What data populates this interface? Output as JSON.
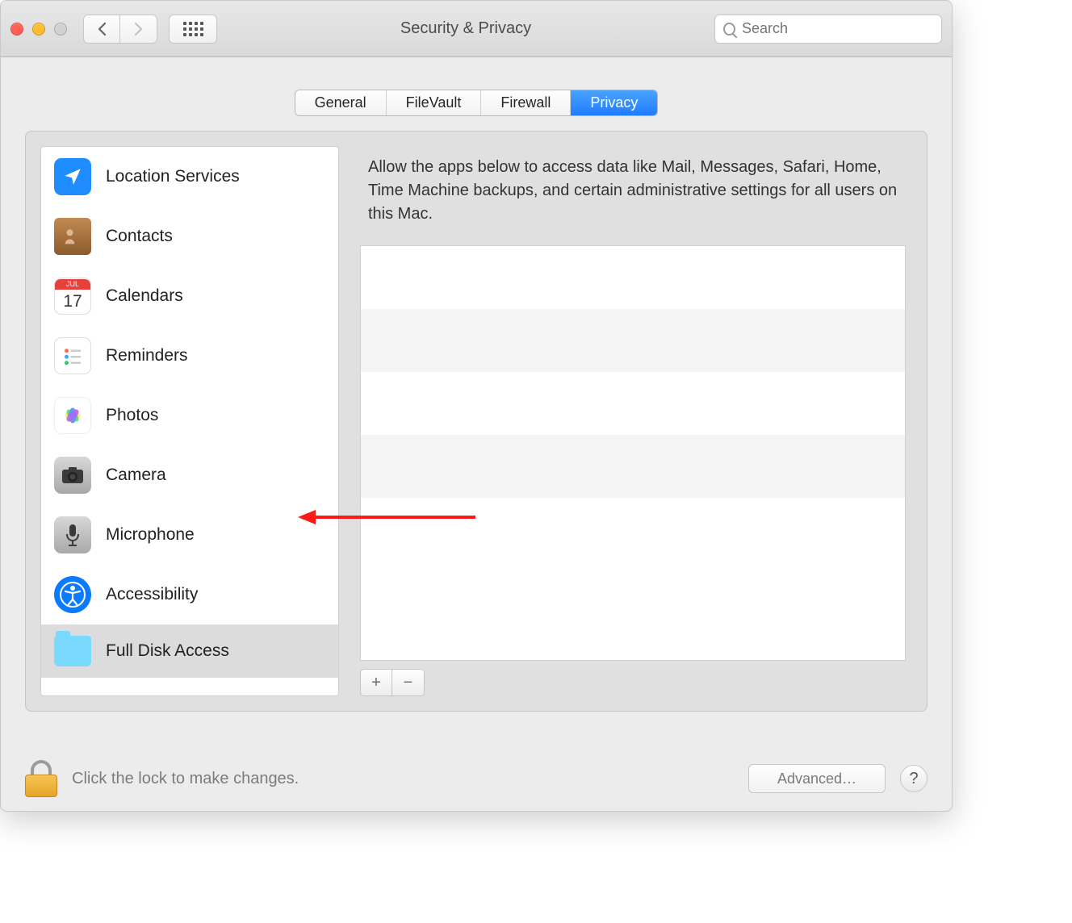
{
  "window": {
    "title": "Security & Privacy"
  },
  "search": {
    "placeholder": "Search"
  },
  "tabs": {
    "items": [
      {
        "label": "General"
      },
      {
        "label": "FileVault"
      },
      {
        "label": "Firewall"
      },
      {
        "label": "Privacy"
      }
    ],
    "active_index": 3
  },
  "sidebar": {
    "items": [
      {
        "label": "Location Services",
        "icon": "location"
      },
      {
        "label": "Contacts",
        "icon": "contacts"
      },
      {
        "label": "Calendars",
        "icon": "calendar",
        "cal_month": "JUL",
        "cal_day": "17"
      },
      {
        "label": "Reminders",
        "icon": "reminders"
      },
      {
        "label": "Photos",
        "icon": "photos"
      },
      {
        "label": "Camera",
        "icon": "camera"
      },
      {
        "label": "Microphone",
        "icon": "microphone"
      },
      {
        "label": "Accessibility",
        "icon": "accessibility"
      },
      {
        "label": "Full Disk Access",
        "icon": "folder"
      }
    ],
    "selected_index": 8
  },
  "detail": {
    "description": "Allow the apps below to access data like Mail, Messages, Safari, Home, Time Machine backups, and certain administrative settings for all users on this Mac."
  },
  "footer": {
    "lock_text": "Click the lock to make changes.",
    "advanced_label": "Advanced…",
    "help_label": "?"
  },
  "buttons": {
    "plus": "+",
    "minus": "−"
  }
}
